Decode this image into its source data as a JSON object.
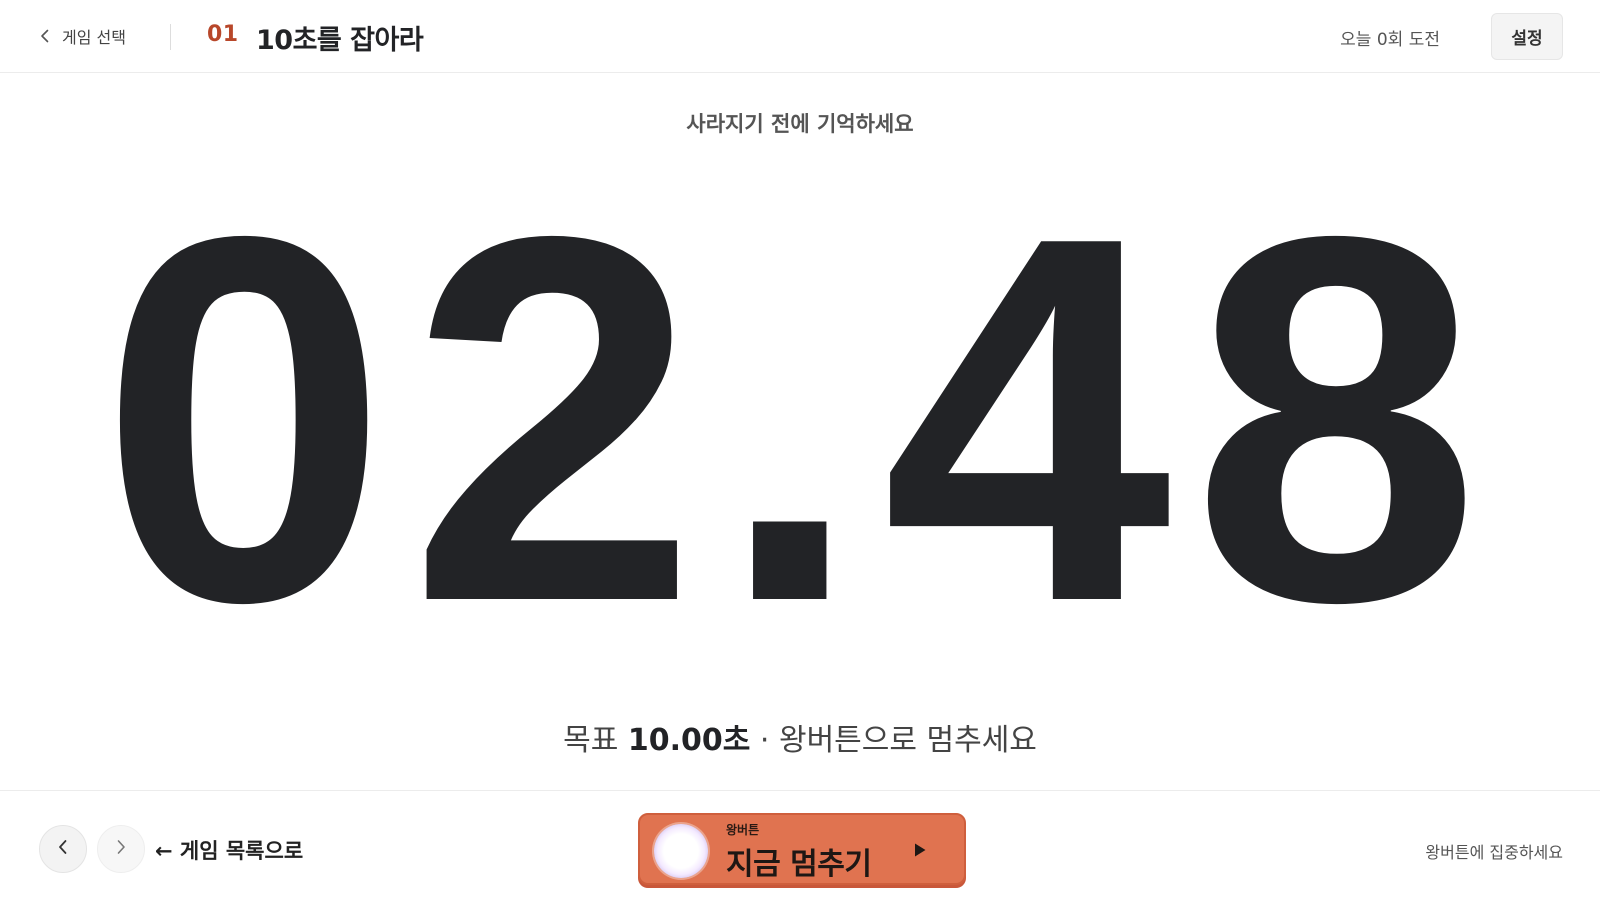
{
  "header": {
    "back_label": "게임 선택",
    "game_number": "01",
    "game_title": "10초를 잡아라",
    "attempts_text": "오늘 0회 도전",
    "settings_label": "설정"
  },
  "main": {
    "prompt": "사라지기 전에 기억하세요",
    "timer_value": "02.48",
    "goal_prefix": "목표",
    "goal_value": "10.00초",
    "goal_suffix": "· 왕버튼으로 멈추세요"
  },
  "footer": {
    "back_to_list_label": "← 게임 목록으로",
    "king_button_small_label": "왕버튼",
    "king_button_main_label": "지금 멈추기",
    "focus_hint": "왕버튼에 집중하세요"
  },
  "icons": {
    "back": "chevron-left-icon",
    "prev": "chevron-left-icon",
    "next": "chevron-right-icon",
    "play": "play-icon"
  },
  "colors": {
    "accent_number": "#b8472a",
    "king_button": "#e07350",
    "text_primary": "#222326"
  }
}
